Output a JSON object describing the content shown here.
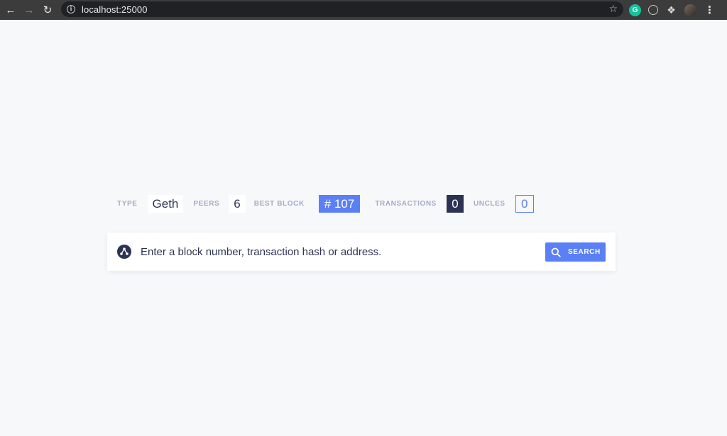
{
  "browser": {
    "url": "localhost:25000",
    "back_icon": "arrow-left-icon",
    "forward_icon": "arrow-right-icon",
    "reload_icon": "reload-icon",
    "extensions": [
      "grammarly-icon",
      "globe-icon",
      "puzzle-icon",
      "profile-avatar"
    ]
  },
  "stats": {
    "type_label": "TYPE",
    "type_value": "Geth",
    "peers_label": "PEERS",
    "peers_value": "6",
    "best_block_label": "BEST BLOCK",
    "best_block_value": "# 107",
    "transactions_label": "TRANSACTIONS",
    "transactions_value": "0",
    "uncles_label": "UNCLES",
    "uncles_value": "0"
  },
  "search": {
    "placeholder": "Enter a block number, transaction hash or address.",
    "button_label": "SEARCH"
  },
  "colors": {
    "accent": "#5b7ff5",
    "dark": "#2b3252",
    "label": "#a3abc6",
    "background": "#f7f8fa"
  }
}
